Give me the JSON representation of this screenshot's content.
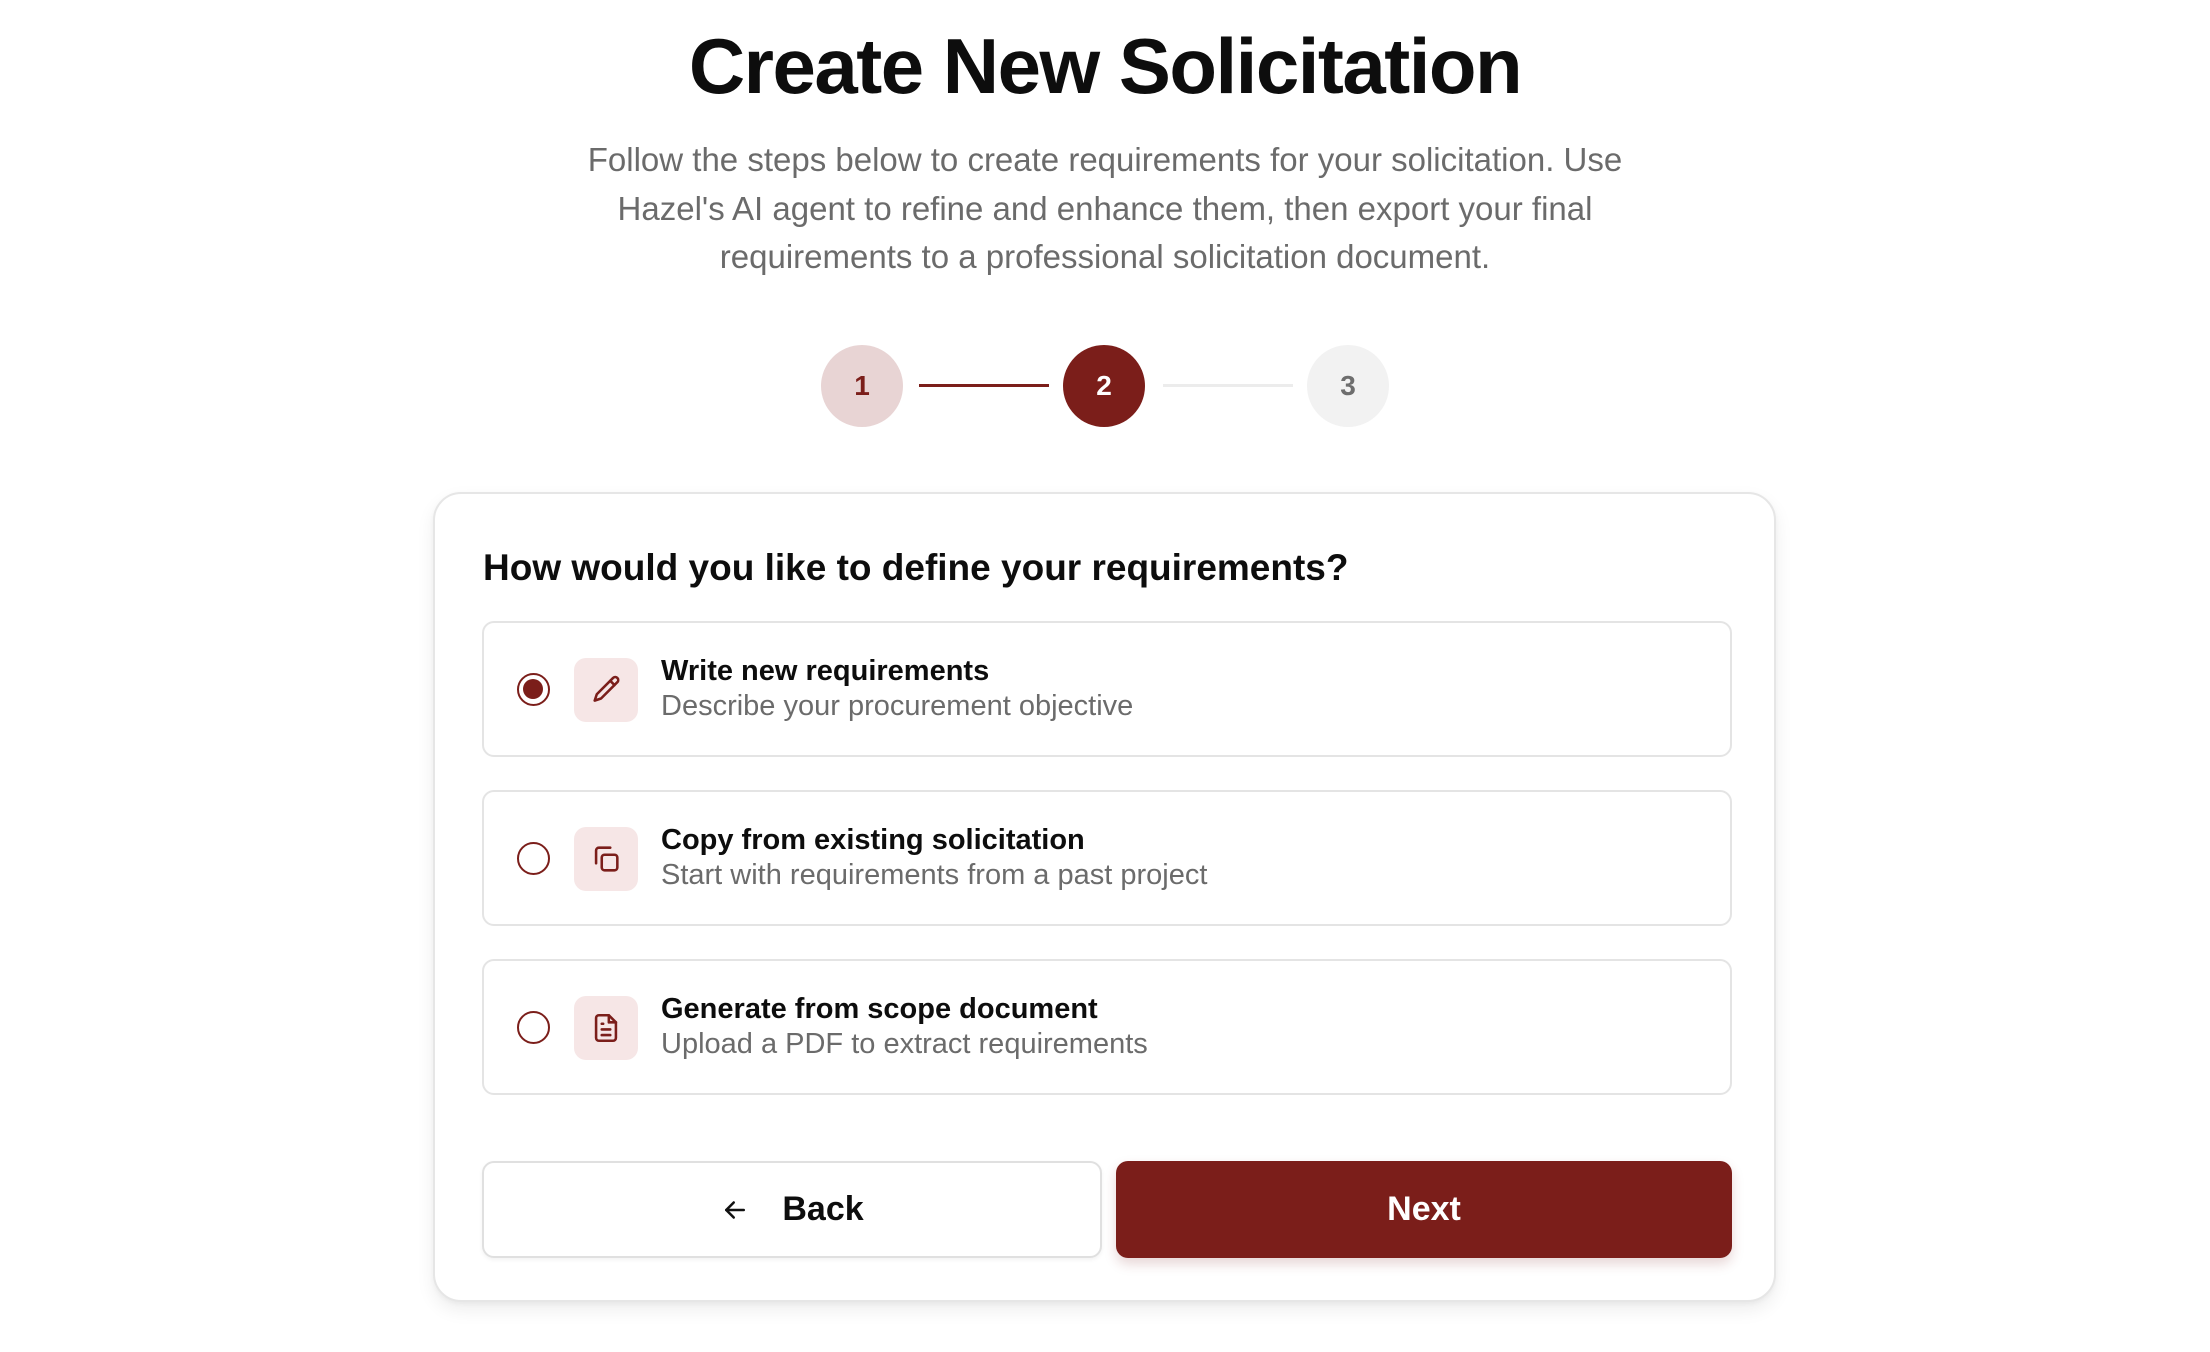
{
  "header": {
    "title": "Create New Solicitation",
    "subtitle": "Follow the steps below to create requirements for your solicitation. Use Hazel's AI agent to refine and enhance them, then export your final requirements to a professional solicitation document."
  },
  "stepper": {
    "current_step": 2,
    "steps": [
      {
        "label": "1",
        "state": "completed"
      },
      {
        "label": "2",
        "state": "active"
      },
      {
        "label": "3",
        "state": "upcoming"
      }
    ]
  },
  "card": {
    "question": "How would you like to define your requirements?",
    "options": [
      {
        "title": "Write new requirements",
        "description": "Describe your procurement objective",
        "icon": "pencil-icon",
        "selected": true
      },
      {
        "title": "Copy from existing solicitation",
        "description": "Start with requirements from a past project",
        "icon": "copy-icon",
        "selected": false
      },
      {
        "title": "Generate from scope document",
        "description": "Upload a PDF to extract requirements",
        "icon": "document-icon",
        "selected": false
      }
    ],
    "back_label": "Back",
    "next_label": "Next"
  },
  "colors": {
    "accent": "#7b1e1a",
    "accent_light": "#e8d4d4",
    "icon_bg": "#f6e6e6",
    "muted_text": "#6b6b6b"
  }
}
